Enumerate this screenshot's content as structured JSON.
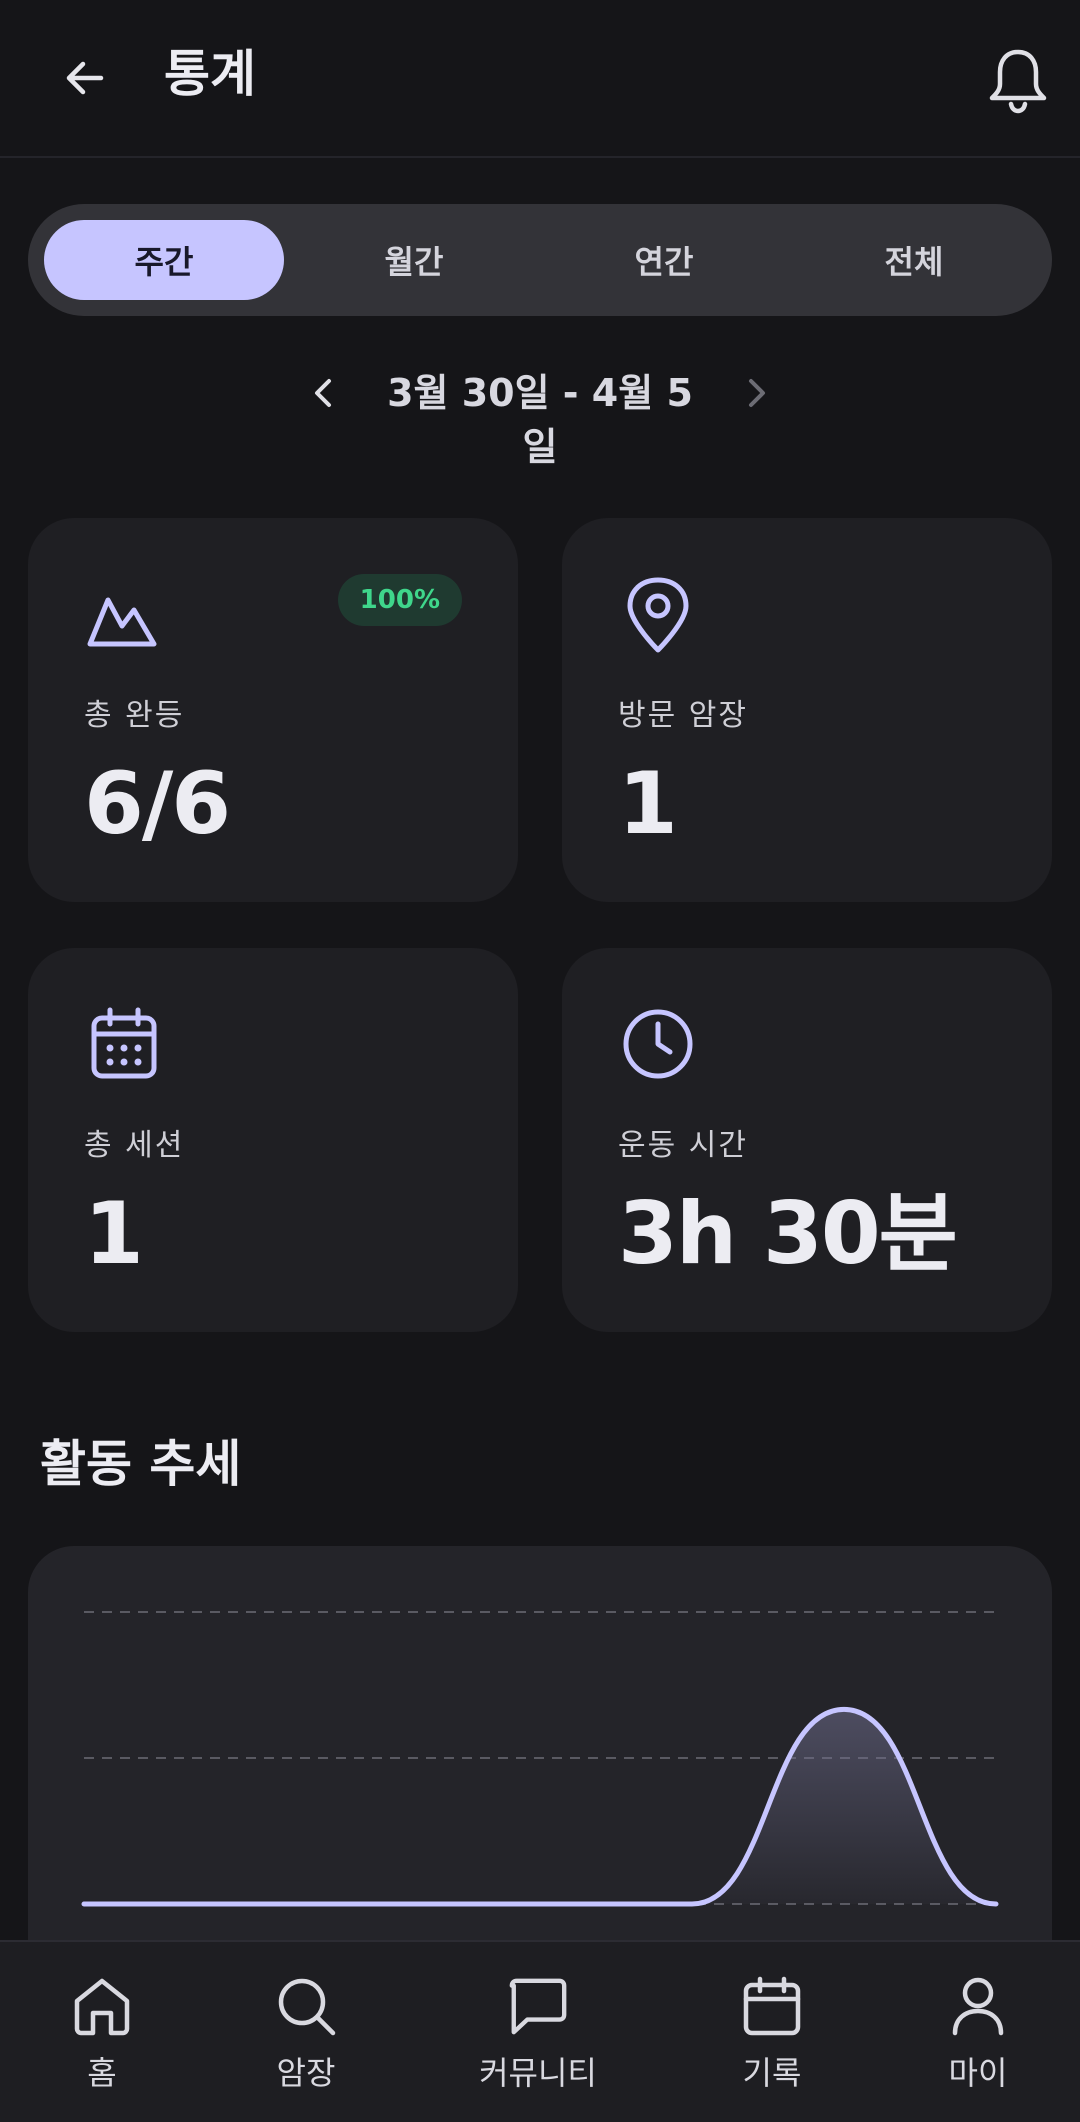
{
  "header": {
    "title": "통계"
  },
  "period_tabs": [
    {
      "label": "주간",
      "active": true
    },
    {
      "label": "월간",
      "active": false
    },
    {
      "label": "연간",
      "active": false
    },
    {
      "label": "전체",
      "active": false
    }
  ],
  "date_range": "3월 30일 - 4월 5일",
  "stats": {
    "completions": {
      "label": "총 완등",
      "value": "6/6",
      "badge": "100%",
      "icon": "mountain-icon"
    },
    "gyms_visited": {
      "label": "방문 암장",
      "value": "1",
      "icon": "map-pin-icon"
    },
    "sessions": {
      "label": "총 세션",
      "value": "1",
      "icon": "calendar-icon"
    },
    "workout_time": {
      "label": "운동 시간",
      "value": "3h 30분",
      "icon": "clock-icon"
    }
  },
  "activity": {
    "title": "활동 추세"
  },
  "chart_data": {
    "type": "line",
    "x": [
      1,
      2,
      3,
      4,
      5,
      6,
      7
    ],
    "values": [
      0,
      0,
      0,
      0,
      0,
      1,
      0
    ],
    "ylim": [
      0,
      1.5
    ],
    "grid": true,
    "color": "#c6c5ff"
  },
  "bottom_nav": [
    {
      "label": "홈",
      "icon": "home-icon"
    },
    {
      "label": "암장",
      "icon": "search-icon"
    },
    {
      "label": "커뮤니티",
      "icon": "chat-icon"
    },
    {
      "label": "기록",
      "icon": "calendar-icon"
    },
    {
      "label": "마이",
      "icon": "user-icon"
    }
  ],
  "colors": {
    "background": "#151518",
    "card": "#1f1f23",
    "accent": "#c6c5ff",
    "badge_text": "#3fd68b",
    "badge_bg": "#1f3a30"
  }
}
